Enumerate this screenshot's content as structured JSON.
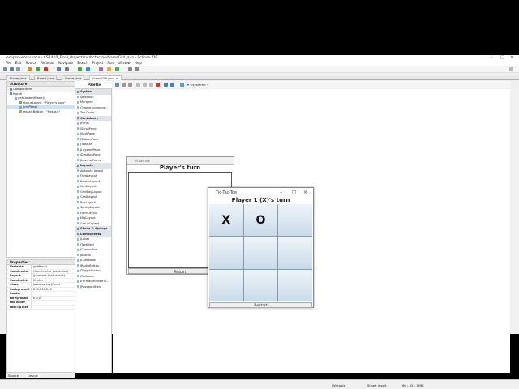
{
  "window": {
    "title": "eclipse-workspace - CS1410_Final_Project/src/tictactoe/GameGUI.java - Eclipse IDE"
  },
  "menu": [
    "File",
    "Edit",
    "Source",
    "Refactor",
    "Navigate",
    "Search",
    "Project",
    "Run",
    "Window",
    "Help"
  ],
  "tabs": [
    {
      "label": "Player.java"
    },
    {
      "label": "Board.java"
    },
    {
      "label": "Game.java"
    },
    {
      "label": "GameGUI.java"
    }
  ],
  "editor_toolbar": {
    "combo": "<system>"
  },
  "structure": {
    "header": "Structure",
    "components_header": "Components",
    "tree": [
      "frame",
      "getContentPane()",
      "statusLabel - \"Player's turn\"",
      "gridPanel",
      "restartButton - \"Restart\""
    ]
  },
  "properties": {
    "header": "Properties",
    "rows": [
      {
        "k": "Variable",
        "v": "gridPanel"
      },
      {
        "k": "Constructor",
        "v": "(Constructor properties)"
      },
      {
        "k": "Layout",
        "v": "(java.awt.GridLayout)"
      },
      {
        "k": "Constraints",
        "v": "Center"
      },
      {
        "k": "Class",
        "v": "javax.swing.JPanel"
      },
      {
        "k": "background",
        "v": "240,240,240"
      },
      {
        "k": "border",
        "v": ""
      },
      {
        "k": "foreground",
        "v": "0,0,0"
      },
      {
        "k": "tab order",
        "v": ""
      },
      {
        "k": "toolTipText",
        "v": ""
      }
    ]
  },
  "palette": {
    "header": "Palette",
    "items": [
      {
        "label": "System",
        "cat": true
      },
      {
        "label": "Selection"
      },
      {
        "label": "Marquee"
      },
      {
        "label": "Choose compone..."
      },
      {
        "label": "Tab Order"
      },
      {
        "label": "Containers",
        "cat": true
      },
      {
        "label": "JPanel"
      },
      {
        "label": "JScrollPane"
      },
      {
        "label": "JSplitPane"
      },
      {
        "label": "JTabbedPane"
      },
      {
        "label": "JToolBar"
      },
      {
        "label": "JLayeredPane"
      },
      {
        "label": "JDesktopPane"
      },
      {
        "label": "JInternalFrame"
      },
      {
        "label": "Layouts",
        "cat": true
      },
      {
        "label": "Absolute layout"
      },
      {
        "label": "FlowLayout"
      },
      {
        "label": "BorderLayout"
      },
      {
        "label": "GridLayout"
      },
      {
        "label": "GridBagLayout"
      },
      {
        "label": "CardLayout"
      },
      {
        "label": "BoxLayout"
      },
      {
        "label": "SpringLayout"
      },
      {
        "label": "FormLayout"
      },
      {
        "label": "MigLayout"
      },
      {
        "label": "GroupLayout"
      },
      {
        "label": "Struts & Springs",
        "cat": true
      },
      {
        "label": "Components",
        "cat": true
      },
      {
        "label": "JLabel"
      },
      {
        "label": "JTextField"
      },
      {
        "label": "JComboBox"
      },
      {
        "label": "JButton"
      },
      {
        "label": "JCheckBox"
      },
      {
        "label": "JRadioButton"
      },
      {
        "label": "JToggleButton"
      },
      {
        "label": "JTextArea"
      },
      {
        "label": "JFormattedTextFie..."
      },
      {
        "label": "JPasswordField"
      }
    ]
  },
  "design_frame": {
    "title": "Tic-Tac-Toe",
    "heading": "Player's turn",
    "restart": "Restart"
  },
  "run_window": {
    "title": "Tic-Tac-Toe",
    "heading": "Player 1 (X)'s turn",
    "cells": [
      "X",
      "O",
      "",
      "",
      "",
      "",
      "",
      "",
      ""
    ],
    "restart": "Restart"
  },
  "bottom_tabs": {
    "source": "Source",
    "design": "Design"
  },
  "status": {
    "writable": "Writable",
    "insert": "Smart Insert",
    "position": "60 : 45 : 1592"
  }
}
